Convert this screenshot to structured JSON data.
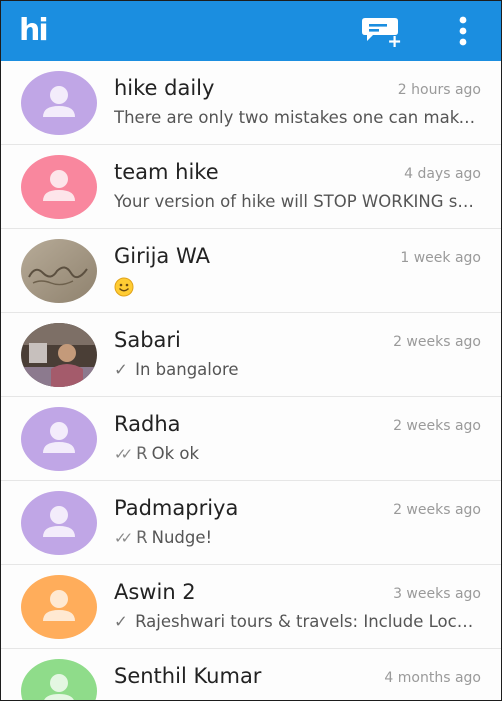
{
  "app": {
    "logo_text": "hi",
    "accent_color": "#1b8ee0"
  },
  "header": {
    "compose_icon": "new-message-icon",
    "menu_icon": "overflow-menu-icon"
  },
  "conversations": [
    {
      "name": "hike daily",
      "time": "2 hours ago",
      "message": "There are only two mistakes one can make along the road to truth",
      "avatar_color": "#c0a6e6",
      "status": ""
    },
    {
      "name": "team hike",
      "time": "4 days ago",
      "message": "Your version of hike will STOP WORKING soon",
      "avatar_color": "#f9879e",
      "status": ""
    },
    {
      "name": "Girija WA",
      "time": "1 week ago",
      "message": "",
      "avatar_color": "#a89a86",
      "status": "",
      "emoji": "smiley-emoji"
    },
    {
      "name": "Sabari",
      "time": "2 weeks ago",
      "message": "In bangalore",
      "avatar_color": "#5a4a3f",
      "status": "sent"
    },
    {
      "name": "Radha",
      "time": "2 weeks ago",
      "message": "Ok ok",
      "avatar_color": "#c0a6e6",
      "status": "read",
      "read_mark": "R"
    },
    {
      "name": "Padmapriya",
      "time": "2 weeks ago",
      "message": "Nudge!",
      "avatar_color": "#c0a6e6",
      "status": "read",
      "read_mark": "R"
    },
    {
      "name": "Aswin 2",
      "time": "3 weeks ago",
      "message": "Rajeshwari tours &  travels: Include Location",
      "avatar_color": "#ffad5b",
      "status": "sent"
    },
    {
      "name": "Senthil Kumar",
      "time": "4 months ago",
      "message": "",
      "avatar_color": "#8fdc8a",
      "status": ""
    }
  ]
}
